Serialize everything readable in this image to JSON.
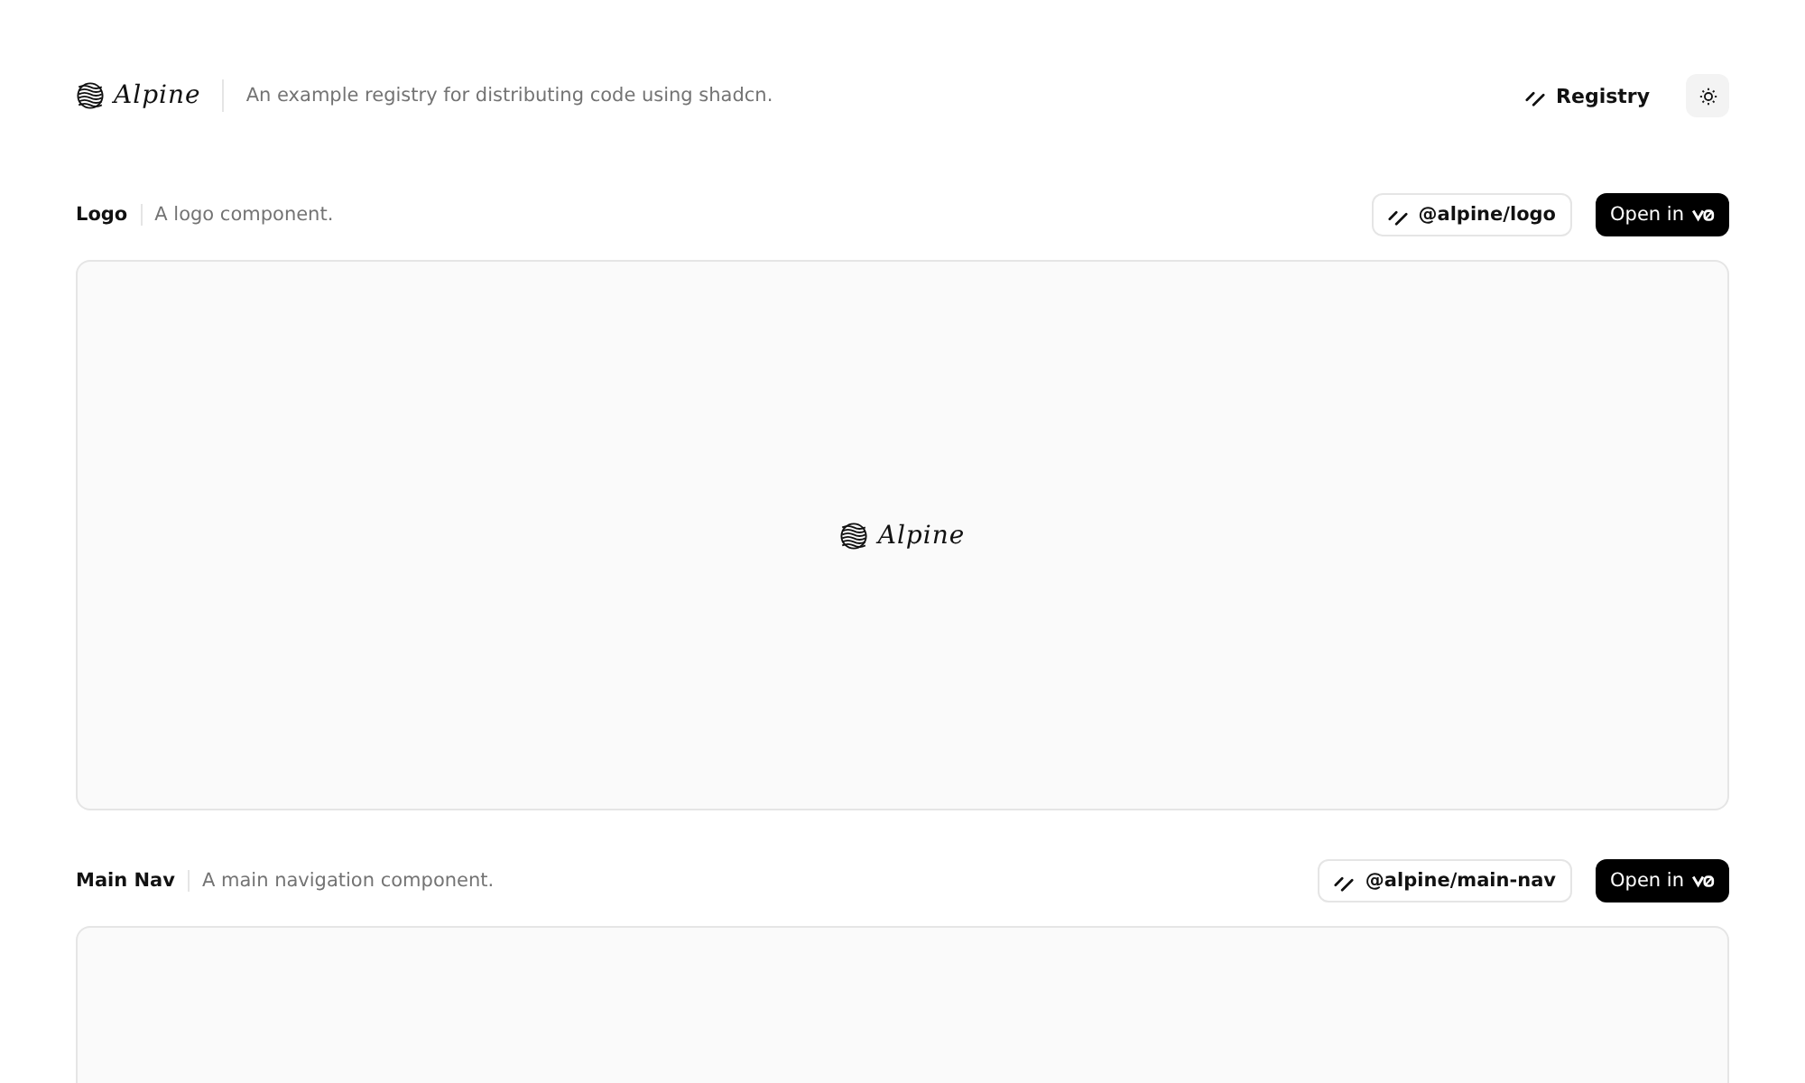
{
  "header": {
    "logo_text": "Alpine",
    "tagline": "An example registry for distributing code using shadcn.",
    "registry_link": "Registry"
  },
  "sections": [
    {
      "title": "Logo",
      "description": "A logo component.",
      "install": "@alpine/logo",
      "open_button": "Open in",
      "preview": {
        "logo_text": "Alpine"
      }
    },
    {
      "title": "Main Nav",
      "description": "A main navigation component.",
      "install": "@alpine/main-nav",
      "open_button": "Open in"
    }
  ]
}
